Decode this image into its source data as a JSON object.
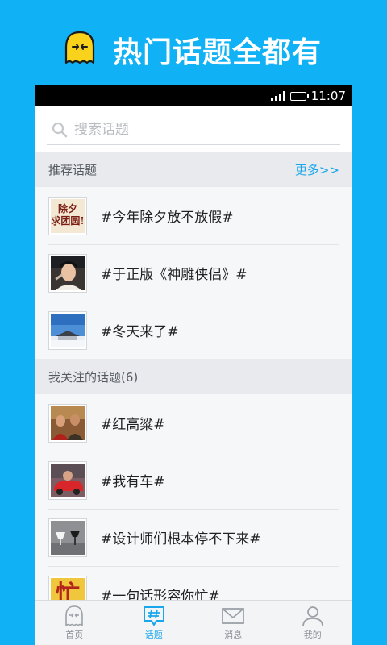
{
  "promo": {
    "title": "热门话题全都有"
  },
  "status_bar": {
    "time": "11:07"
  },
  "search": {
    "placeholder": "搜索话题"
  },
  "recommended": {
    "title": "推荐话题",
    "more_label": "更多>>",
    "items": [
      {
        "label": "#今年除夕放不放假#",
        "thumb_text": "除夕\n求团圆!"
      },
      {
        "label": "#于正版《神雕侠侣》#"
      },
      {
        "label": "#冬天来了#"
      }
    ]
  },
  "following": {
    "title": "我关注的话题(6)",
    "items": [
      {
        "label": "#红高粱#"
      },
      {
        "label": "#我有车#"
      },
      {
        "label": "#设计师们根本停不下来#"
      },
      {
        "label": "#一句话形容你忙#",
        "thumb_text": "忙"
      }
    ]
  },
  "tabs": [
    {
      "label": "首页",
      "icon": "ghost-icon",
      "active": false
    },
    {
      "label": "话题",
      "icon": "hashtag-bubble-icon",
      "active": true
    },
    {
      "label": "消息",
      "icon": "envelope-icon",
      "active": false
    },
    {
      "label": "我的",
      "icon": "person-icon",
      "active": false
    }
  ],
  "colors": {
    "brand_blue": "#10b2f5",
    "accent": "#1aa6ea",
    "mascot_yellow": "#f8d21b"
  }
}
